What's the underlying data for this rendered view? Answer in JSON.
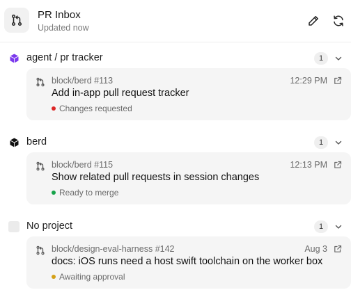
{
  "header": {
    "title": "PR Inbox",
    "subtitle": "Updated now",
    "app_icon": "git-pull-request-icon",
    "edit_icon": "pencil-icon",
    "refresh_icon": "refresh-icon"
  },
  "groups": [
    {
      "name": "agent / pr tracker",
      "icon": "cube-icon",
      "icon_color": "#7c3aed",
      "count": "1",
      "items": [
        {
          "repo": "block/berd #113",
          "time": "12:29 PM",
          "title": "Add in-app pull request tracker",
          "status": "Changes requested",
          "status_color": "#dc2626"
        }
      ]
    },
    {
      "name": "berd",
      "icon": "cube-icon",
      "icon_color": "#111111",
      "count": "1",
      "items": [
        {
          "repo": "block/berd #115",
          "time": "12:13 PM",
          "title": "Show related pull requests in session changes",
          "status": "Ready to merge",
          "status_color": "#16a34a"
        }
      ]
    },
    {
      "name": "No project",
      "icon": "empty-square-icon",
      "icon_color": "#ebebeb",
      "count": "1",
      "items": [
        {
          "repo": "block/design-eval-harness #142",
          "time": "Aug 3",
          "title": "docs: iOS runs need a host swift toolchain on the worker box",
          "status": "Awaiting approval",
          "status_color": "#d4a017"
        }
      ]
    }
  ]
}
